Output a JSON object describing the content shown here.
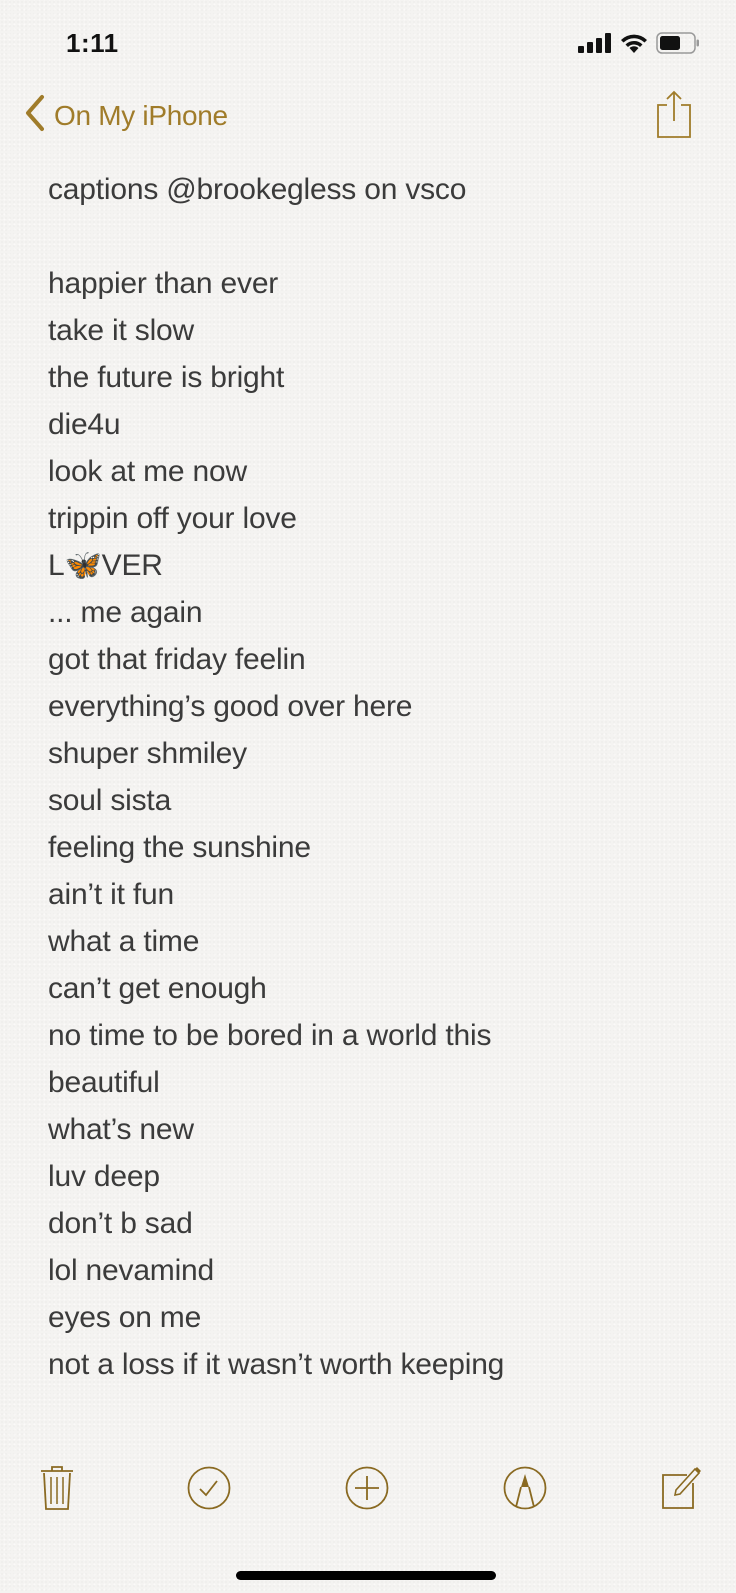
{
  "status_bar": {
    "time": "1:11",
    "icons": [
      "cellular-signal-icon",
      "wifi-icon",
      "battery-icon"
    ]
  },
  "nav": {
    "back_label": "On My iPhone",
    "back_icon": "chevron-left-icon",
    "share_icon": "share-icon",
    "accent_color": "#a07c2a"
  },
  "note": {
    "title": "captions @brookegless on vsco",
    "lines": [
      "",
      "happier than ever",
      "take it slow",
      "the future is bright",
      "die4u",
      "look at me now",
      "trippin off your love",
      "L🦋VER",
      "... me again",
      "got that friday feelin",
      "everything’s good over here",
      "shuper shmiley",
      "soul sista",
      "feeling the sunshine",
      "ain’t it fun",
      "what a time",
      "can’t get enough",
      "no time to be bored in a world this",
      "beautiful",
      "what’s new",
      "luv deep",
      "don’t b sad",
      "lol nevamind",
      "eyes on me",
      "not a loss if it wasn’t worth keeping"
    ]
  },
  "toolbar": {
    "items": [
      {
        "name": "delete",
        "icon": "trash-icon"
      },
      {
        "name": "checklist",
        "icon": "checkmark-circle-icon"
      },
      {
        "name": "add",
        "icon": "plus-circle-icon"
      },
      {
        "name": "markup",
        "icon": "pen-tip-circle-icon"
      },
      {
        "name": "compose",
        "icon": "compose-icon"
      }
    ]
  }
}
